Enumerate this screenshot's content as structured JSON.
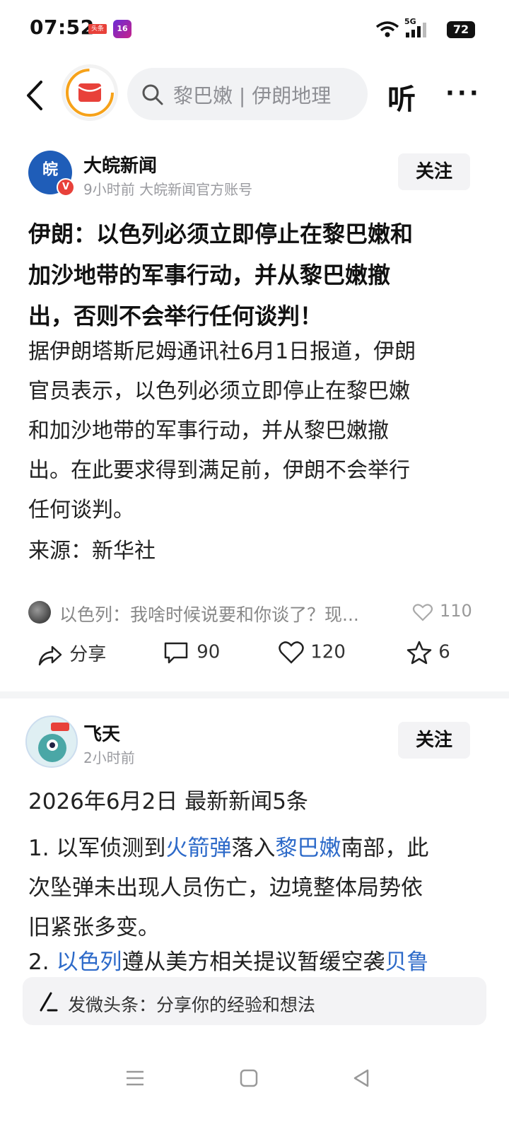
{
  "status_bar": {
    "time": "07:52",
    "app_badge": "头条",
    "app_badge_2": "16",
    "network": "5G",
    "battery": "72"
  },
  "top_bar": {
    "search_placeholder": "黎巴嫩 | 伊朗地理",
    "listen_label": "听",
    "more_label": "···"
  },
  "post1": {
    "author": "大皖新闻",
    "meta": "9小时前  大皖新闻官方账号",
    "follow_label": "关注",
    "title_lines": [
      "伊朗：以色列必须立即停止在黎巴嫩和",
      "加沙地带的军事行动，并从黎巴嫩撤",
      "出，否则不会举行任何谈判！"
    ],
    "body_lines": [
      "据伊朗塔斯尼姆通讯社6月1日报道，伊朗",
      "官员表示，以色列必须立即停止在黎巴嫩",
      "和加沙地带的军事行动，并从黎巴嫩撤",
      "出。在此要求得到满足前，伊朗不会举行",
      "任何谈判。"
    ],
    "source": "来源：新华社",
    "top_comment": "以色列：我啥时候说要和你谈了？现...",
    "top_comment_likes": "110",
    "share_label": "分享",
    "comments_count": "90",
    "likes_count": "120",
    "favorites_count": "6"
  },
  "post2": {
    "author": "飞天",
    "meta": "2小时前",
    "follow_label": "关注",
    "heading": "2026年6月2日  最新新闻5条",
    "item1": {
      "a": "1. 以军侦测到",
      "link1": "火箭弹",
      "b": "落入",
      "link2": "黎巴嫩",
      "c": "南部，此",
      "line2": "次坠弹未出现人员伤亡，边境整体局势依",
      "line3": "旧紧张多变。"
    },
    "item2": {
      "a": "2. ",
      "link1": "以色列",
      "b": "遵从美方相关提议暂缓空袭",
      "link2": "贝鲁"
    }
  },
  "compose": {
    "placeholder": "发微头条：分享你的经验和想法"
  },
  "colors": {
    "link": "#2d6ac9",
    "accent_red": "#e8413a"
  }
}
